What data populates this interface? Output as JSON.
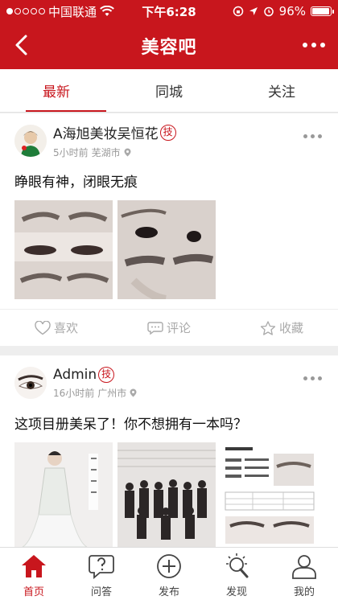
{
  "status": {
    "carrier": "中国联通",
    "time": "下午6:28",
    "battery": "96%",
    "battery_level": 0.96
  },
  "nav": {
    "title": "美容吧"
  },
  "tabs": [
    {
      "label": "最新",
      "active": true
    },
    {
      "label": "同城",
      "active": false
    },
    {
      "label": "关注",
      "active": false
    }
  ],
  "posts": [
    {
      "user": "A海旭美妆吴恒花",
      "badge": "技",
      "time": "5小时前",
      "location": "芜湖市",
      "text": "睁眼有神，闭眼无痕",
      "actions": {
        "like": "喜欢",
        "comment": "评论",
        "favorite": "收藏"
      }
    },
    {
      "user": "Admin",
      "badge": "技",
      "time": "16小时前",
      "location": "广州市",
      "text": "这项目册美呆了！你不想拥有一本吗？"
    }
  ],
  "tabbar": [
    {
      "label": "首页",
      "icon": "home-icon",
      "active": true
    },
    {
      "label": "问答",
      "icon": "qa-icon",
      "active": false
    },
    {
      "label": "发布",
      "icon": "publish-icon",
      "active": false
    },
    {
      "label": "发现",
      "icon": "discover-icon",
      "active": false
    },
    {
      "label": "我的",
      "icon": "profile-icon",
      "active": false
    }
  ],
  "colors": {
    "brand": "#c8161d",
    "muted": "#999999"
  }
}
